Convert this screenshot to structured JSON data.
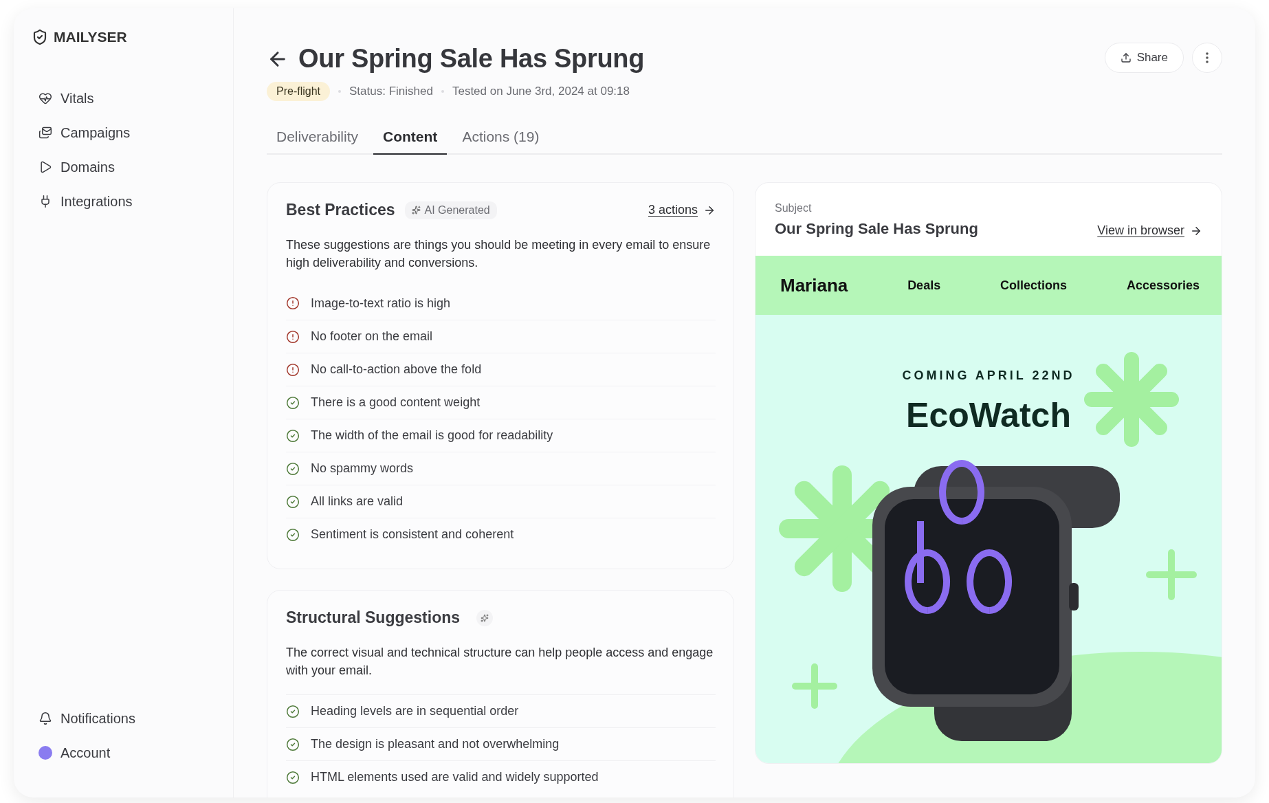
{
  "sidebar": {
    "logo": "MAILYSER",
    "items": [
      {
        "label": "Vitals",
        "kind": "vitals"
      },
      {
        "label": "Campaigns",
        "kind": "campaigns"
      },
      {
        "label": "Domains",
        "kind": "domains"
      },
      {
        "label": "Integrations",
        "kind": "integrations"
      }
    ],
    "bottom_items": [
      {
        "label": "Notifications",
        "kind": "notifications"
      },
      {
        "label": "Account",
        "kind": "account"
      }
    ]
  },
  "header": {
    "title": "Our Spring Sale Has Sprung",
    "badge": "Pre-flight",
    "status": "Status: Finished",
    "tested": "Tested on June 3rd, 2024 at 09:18",
    "share": "Share"
  },
  "tabs": [
    {
      "label": "Deliverability",
      "selected": false
    },
    {
      "label": "Content",
      "selected": true
    },
    {
      "label": "Actions (19)",
      "selected": false
    }
  ],
  "best_practices": {
    "title": "Best Practices",
    "tag": "AI Generated",
    "link": "3 actions",
    "description": "These suggestions are things you should be meeting in every email to ensure high deliverability and conversions.",
    "items": [
      {
        "text": "Image-to-text ratio is high",
        "kind": "warning"
      },
      {
        "text": "No footer on the email",
        "kind": "warning"
      },
      {
        "text": "No call-to-action above the fold",
        "kind": "warning"
      },
      {
        "text": "There is a good content weight",
        "kind": "pass"
      },
      {
        "text": "The width of the email is good for readability",
        "kind": "pass"
      },
      {
        "text": "No spammy words",
        "kind": "pass"
      },
      {
        "text": "All links are valid",
        "kind": "pass"
      },
      {
        "text": "Sentiment is consistent and coherent",
        "kind": "pass"
      }
    ]
  },
  "structural": {
    "title": "Structural Suggestions",
    "description": "The correct visual and technical structure can help people access and engage with your email.",
    "items": [
      {
        "text": "Heading levels are in sequential order",
        "kind": "pass"
      },
      {
        "text": "The design is pleasant and not overwhelming",
        "kind": "pass"
      },
      {
        "text": "HTML elements used are valid and widely supported",
        "kind": "pass"
      }
    ]
  },
  "preview": {
    "subject_label": "Subject",
    "subject": "Our Spring Sale Has Sprung",
    "link": "View in browser",
    "brand": "Mariana",
    "nav": [
      "Deals",
      "Collections",
      "Accessories"
    ],
    "eyebrow": "COMING APRIL 22ND",
    "product": "EcoWatch"
  }
}
